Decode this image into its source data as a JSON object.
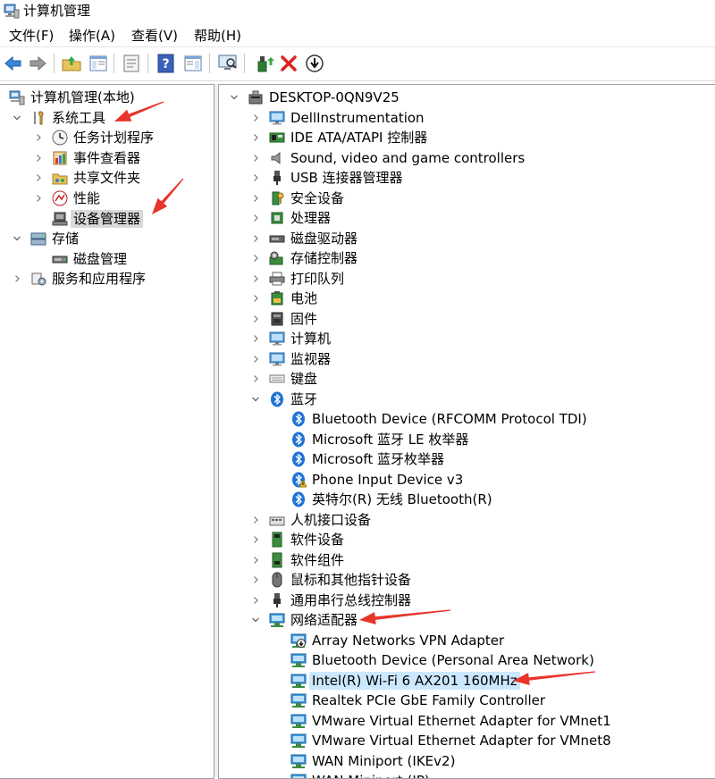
{
  "window": {
    "title": "计算机管理"
  },
  "menu": [
    {
      "label": "文件(F)"
    },
    {
      "label": "操作(A)"
    },
    {
      "label": "查看(V)"
    },
    {
      "label": "帮助(H)"
    }
  ],
  "toolbar": {
    "icons": [
      "back-arrow-icon",
      "forward-arrow-icon",
      "up-folder-icon",
      "show-hide-tree-icon",
      "properties-icon",
      "help-icon",
      "action-pane-icon",
      "scan-hardware-icon",
      "update-driver-icon",
      "uninstall-icon",
      "disable-device-icon"
    ]
  },
  "left_tree": [
    {
      "label": "计算机管理(本地)",
      "level": 0,
      "icon": "computer-management-icon",
      "chevron": "down"
    },
    {
      "label": "系统工具",
      "level": 1,
      "icon": "tools-icon",
      "chevron": "down"
    },
    {
      "label": "任务计划程序",
      "level": 2,
      "icon": "clock-icon",
      "chevron": "right"
    },
    {
      "label": "事件查看器",
      "level": 2,
      "icon": "event-viewer-icon",
      "chevron": "right"
    },
    {
      "label": "共享文件夹",
      "level": 2,
      "icon": "shared-folder-icon",
      "chevron": "right"
    },
    {
      "label": "性能",
      "level": 2,
      "icon": "performance-icon",
      "chevron": "right"
    },
    {
      "label": "设备管理器",
      "level": 2,
      "icon": "device-manager-icon",
      "chevron": "none",
      "selected": true
    },
    {
      "label": "存储",
      "level": 1,
      "icon": "storage-icon",
      "chevron": "down"
    },
    {
      "label": "磁盘管理",
      "level": 2,
      "icon": "disk-icon",
      "chevron": "none"
    },
    {
      "label": "服务和应用程序",
      "level": 1,
      "icon": "services-icon",
      "chevron": "right"
    }
  ],
  "right_tree": [
    {
      "label": "DESKTOP-0QN9V25",
      "level": 0,
      "icon": "computer-tower-icon",
      "chevron": "down"
    },
    {
      "label": "DellInstrumentation",
      "level": 1,
      "icon": "monitor-icon",
      "chevron": "right"
    },
    {
      "label": "IDE ATA/ATAPI 控制器",
      "level": 1,
      "icon": "ide-controller-icon",
      "chevron": "right"
    },
    {
      "label": "Sound, video and game controllers",
      "level": 1,
      "icon": "speaker-icon",
      "chevron": "right"
    },
    {
      "label": "USB 连接器管理器",
      "level": 1,
      "icon": "usb-icon",
      "chevron": "right"
    },
    {
      "label": "安全设备",
      "level": 1,
      "icon": "security-key-icon",
      "chevron": "right"
    },
    {
      "label": "处理器",
      "level": 1,
      "icon": "processor-icon",
      "chevron": "right"
    },
    {
      "label": "磁盘驱动器",
      "level": 1,
      "icon": "disk-drive-icon",
      "chevron": "right"
    },
    {
      "label": "存储控制器",
      "level": 1,
      "icon": "storage-controller-icon",
      "chevron": "right"
    },
    {
      "label": "打印队列",
      "level": 1,
      "icon": "printer-icon",
      "chevron": "right"
    },
    {
      "label": "电池",
      "level": 1,
      "icon": "battery-icon",
      "chevron": "right"
    },
    {
      "label": "固件",
      "level": 1,
      "icon": "firmware-icon",
      "chevron": "right"
    },
    {
      "label": "计算机",
      "level": 1,
      "icon": "monitor-icon",
      "chevron": "right"
    },
    {
      "label": "监视器",
      "level": 1,
      "icon": "monitor-icon",
      "chevron": "right"
    },
    {
      "label": "键盘",
      "level": 1,
      "icon": "keyboard-icon",
      "chevron": "right"
    },
    {
      "label": "蓝牙",
      "level": 1,
      "icon": "bluetooth-icon",
      "chevron": "down"
    },
    {
      "label": "Bluetooth Device (RFCOMM Protocol TDI)",
      "level": 2,
      "icon": "bluetooth-icon",
      "chevron": "none"
    },
    {
      "label": "Microsoft 蓝牙 LE 枚举器",
      "level": 2,
      "icon": "bluetooth-icon",
      "chevron": "none"
    },
    {
      "label": "Microsoft 蓝牙枚举器",
      "level": 2,
      "icon": "bluetooth-icon",
      "chevron": "none"
    },
    {
      "label": "Phone Input Device v3",
      "level": 2,
      "icon": "bluetooth-warning-icon",
      "chevron": "none"
    },
    {
      "label": "英特尔(R) 无线 Bluetooth(R)",
      "level": 2,
      "icon": "bluetooth-icon",
      "chevron": "none"
    },
    {
      "label": "人机接口设备",
      "level": 1,
      "icon": "hid-icon",
      "chevron": "right"
    },
    {
      "label": "软件设备",
      "level": 1,
      "icon": "software-device-icon",
      "chevron": "right"
    },
    {
      "label": "软件组件",
      "level": 1,
      "icon": "software-component-icon",
      "chevron": "right"
    },
    {
      "label": "鼠标和其他指针设备",
      "level": 1,
      "icon": "mouse-icon",
      "chevron": "right"
    },
    {
      "label": "通用串行总线控制器",
      "level": 1,
      "icon": "usb-icon",
      "chevron": "right"
    },
    {
      "label": "网络适配器",
      "level": 1,
      "icon": "network-adapter-icon",
      "chevron": "down"
    },
    {
      "label": "Array Networks VPN Adapter",
      "level": 2,
      "icon": "network-adapter-down-icon",
      "chevron": "none"
    },
    {
      "label": "Bluetooth Device (Personal Area Network)",
      "level": 2,
      "icon": "network-adapter-icon",
      "chevron": "none"
    },
    {
      "label": "Intel(R) Wi-Fi 6 AX201 160MHz",
      "level": 2,
      "icon": "network-adapter-icon",
      "chevron": "none",
      "selected": true
    },
    {
      "label": "Realtek PCIe GbE Family Controller",
      "level": 2,
      "icon": "network-adapter-icon",
      "chevron": "none"
    },
    {
      "label": "VMware Virtual Ethernet Adapter for VMnet1",
      "level": 2,
      "icon": "network-adapter-icon",
      "chevron": "none"
    },
    {
      "label": "VMware Virtual Ethernet Adapter for VMnet8",
      "level": 2,
      "icon": "network-adapter-icon",
      "chevron": "none"
    },
    {
      "label": "WAN Miniport (IKEv2)",
      "level": 2,
      "icon": "network-adapter-icon",
      "chevron": "none"
    },
    {
      "label": "WAN Miniport (IP)",
      "level": 2,
      "icon": "network-adapter-icon",
      "chevron": "none"
    }
  ],
  "annotation_color": "#e8342a"
}
